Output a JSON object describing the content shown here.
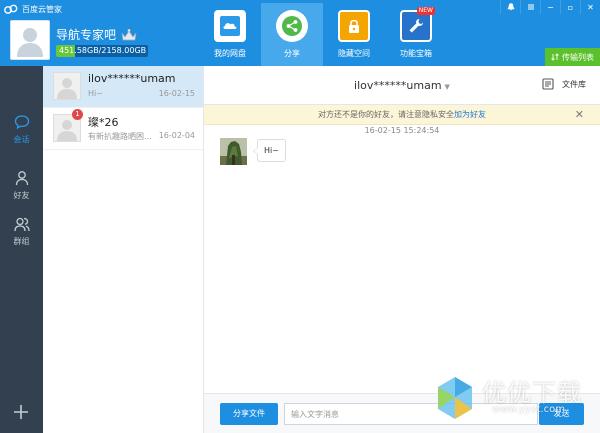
{
  "app": {
    "title": "百度云管家"
  },
  "window_controls": {
    "minimize": "−",
    "maximize": "▫",
    "close": "✕"
  },
  "user": {
    "name": "导航专家吧",
    "quota_text": "451.58GB/2158.00GB",
    "quota_used_fraction": 0.21
  },
  "nav": {
    "tabs": [
      {
        "label": "我的网盘",
        "icon": "cloud-disk-icon"
      },
      {
        "label": "分享",
        "icon": "share-icon",
        "active": true
      },
      {
        "label": "隐藏空间",
        "icon": "lock-icon"
      },
      {
        "label": "功能宝箱",
        "icon": "wrench-icon",
        "badge": "NEW"
      }
    ]
  },
  "transfer": {
    "label": "传输列表"
  },
  "sidebar": {
    "items": [
      {
        "label": "会话",
        "icon": "chat-bubble-icon",
        "active": true
      },
      {
        "label": "好友",
        "icon": "person-icon"
      },
      {
        "label": "群组",
        "icon": "group-icon"
      }
    ],
    "add_icon": "plus-icon"
  },
  "conversations": [
    {
      "name": "ilov******umam",
      "message": "Hi~",
      "date": "16-02-15",
      "active": true,
      "badge": ""
    },
    {
      "name": "璨*26",
      "message": "有新扒趣路晒困...",
      "date": "16-02-04",
      "active": false,
      "badge": "1"
    }
  ],
  "chat": {
    "title": "ilov******umam",
    "title_caret": "▼",
    "files_label": "文件库",
    "notice_text": "对方还不是你的好友，请注意隐私安全",
    "notice_link": "加为好友",
    "notice_close": "✕",
    "message_time": "16-02-15   15:24:54",
    "message_text": "Hi~"
  },
  "footer": {
    "share_file_label": "分享文件",
    "input_placeholder": "输入文字消息",
    "send_label": "发送"
  },
  "watermark": {
    "text": "优优下载",
    "url": "www.yyxt.com"
  },
  "colors": {
    "brand_blue": "#1e8fe0",
    "sidebar_bg": "#33404f",
    "transfer_green": "#5ac02b",
    "notice_bg": "#fdf5d7"
  }
}
